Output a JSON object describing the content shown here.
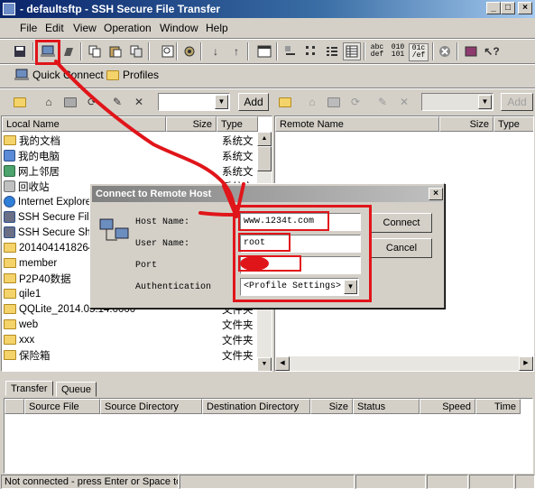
{
  "window": {
    "title": "- defaultsftp - SSH Secure File Transfer",
    "minimize": "_",
    "maximize": "□",
    "close": "×"
  },
  "menu": [
    "File",
    "Edit",
    "View",
    "Operation",
    "Window",
    "Help"
  ],
  "toolbar": {
    "text_mode_labels": [
      "abc def",
      "010 101",
      "01c /ef"
    ]
  },
  "shortcuts": {
    "quick_connect": "Quick Connect",
    "profiles": "Profiles"
  },
  "local_toolbar": {
    "add_label": "Add"
  },
  "remote_toolbar": {
    "add_label": "Add"
  },
  "local_pane": {
    "headers": {
      "name": "Local Name",
      "size": "Size",
      "type": "Type"
    },
    "rows": [
      {
        "name": "我的文档",
        "type": "系统文",
        "icon": "folder-icon"
      },
      {
        "name": "我的电脑",
        "type": "系统文",
        "icon": "computer-icon"
      },
      {
        "name": "网上邻居",
        "type": "系统文",
        "icon": "network-icon"
      },
      {
        "name": "回收站",
        "type": "系统文",
        "icon": "recycle-bin-icon"
      },
      {
        "name": "Internet Explore",
        "type": "",
        "icon": "ie-icon"
      },
      {
        "name": "SSH Secure File T",
        "type": "",
        "icon": "ssh-icon"
      },
      {
        "name": "SSH Secure Shell",
        "type": "",
        "icon": "ssh-icon"
      },
      {
        "name": "2014041418264",
        "type": "",
        "icon": "folder-icon"
      },
      {
        "name": "member",
        "type": "",
        "icon": "folder-icon"
      },
      {
        "name": "P2P40数据",
        "type": "",
        "icon": "folder-icon"
      },
      {
        "name": "qile1",
        "type": "",
        "icon": "folder-icon"
      },
      {
        "name": "QQLite_2014.05.14.0000",
        "type": "文件夹",
        "icon": "folder-icon"
      },
      {
        "name": "web",
        "type": "文件夹",
        "icon": "folder-icon"
      },
      {
        "name": "xxx",
        "type": "文件夹",
        "icon": "folder-icon"
      },
      {
        "name": "保险箱",
        "type": "文件夹",
        "icon": "folder-icon"
      }
    ]
  },
  "remote_pane": {
    "headers": {
      "name": "Remote Name",
      "size": "Size",
      "type": "Type"
    }
  },
  "dialog": {
    "title": "Connect to Remote Host",
    "host_label": "Host Name:",
    "host_value": "www.1234t.com",
    "user_label": "User Name:",
    "user_value": "root",
    "port_label": "Port",
    "port_value": "",
    "auth_label": "Authentication",
    "auth_value": "<Profile Settings>",
    "connect_label": "Connect",
    "cancel_label": "Cancel"
  },
  "transfer": {
    "tabs": [
      "Transfer",
      "Queue"
    ],
    "headers": [
      "Source File",
      "Source Directory",
      "Destination Directory",
      "Size",
      "Status",
      "Speed",
      "Time"
    ]
  },
  "statusbar": {
    "text": "Not connected - press Enter or Space to"
  },
  "colors": {
    "title_bar": "#0a246a",
    "annotation_red": "#e0151a"
  }
}
